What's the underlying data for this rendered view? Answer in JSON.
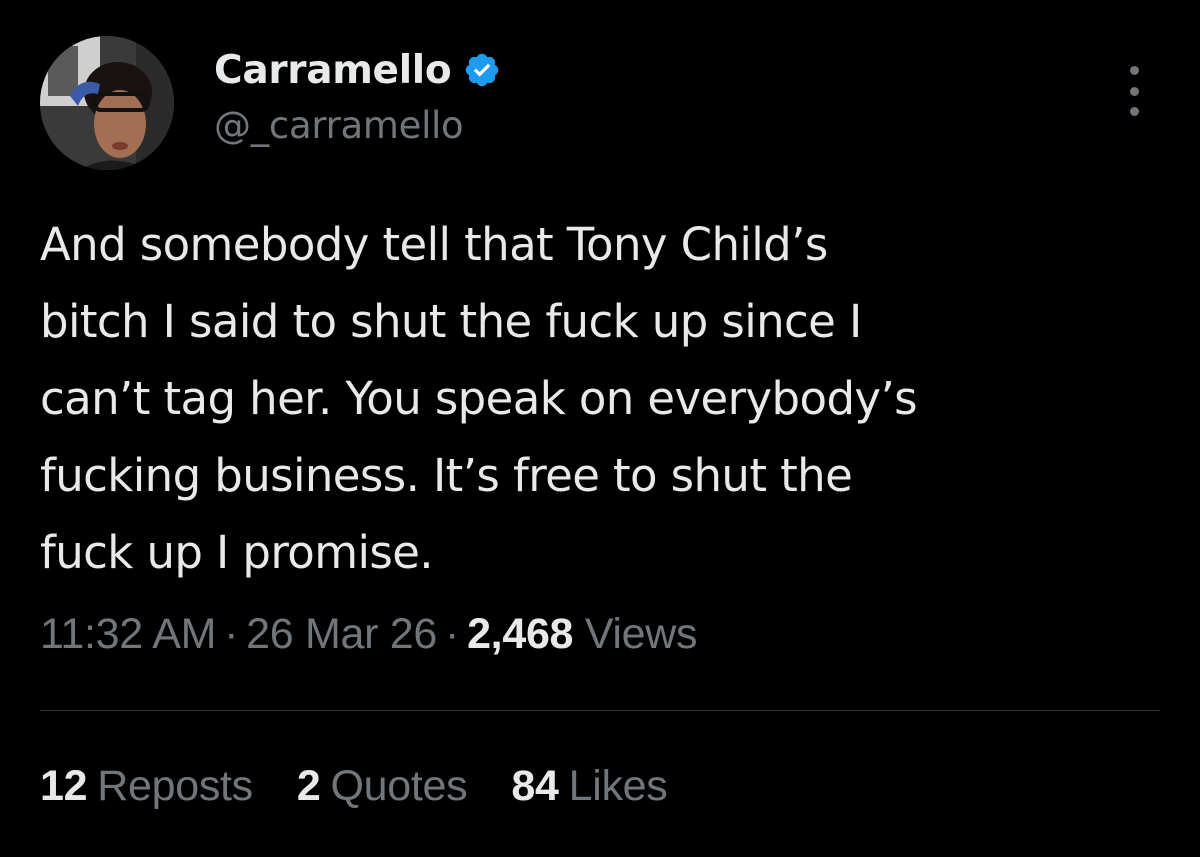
{
  "author": {
    "display_name": "Carramello",
    "handle": "@_carramello",
    "verified_color": "#1d9bf0"
  },
  "tweet": {
    "lines": [
      "And somebody tell that Tony Child’s",
      "bitch I said to shut the fuck up since I",
      "can’t tag her. You speak on everybody’s",
      "fucking business. It’s free to shut the",
      "fuck up I promise."
    ],
    "time": "11:32 AM",
    "separator": "·",
    "date": "26 Mar 26",
    "views_count": "2,468",
    "views_label": "Views"
  },
  "stats": {
    "reposts_count": "12",
    "reposts_label": "Reposts",
    "quotes_count": "2",
    "quotes_label": "Quotes",
    "likes_count": "84",
    "likes_label": "Likes"
  },
  "icons": {
    "verified": "verified-badge-icon",
    "more": "more-options-icon"
  },
  "colors": {
    "background": "#000000",
    "primary_text": "#e7e9ea",
    "secondary_text": "#71767b",
    "divider": "#2f3336",
    "accent": "#1d9bf0"
  }
}
